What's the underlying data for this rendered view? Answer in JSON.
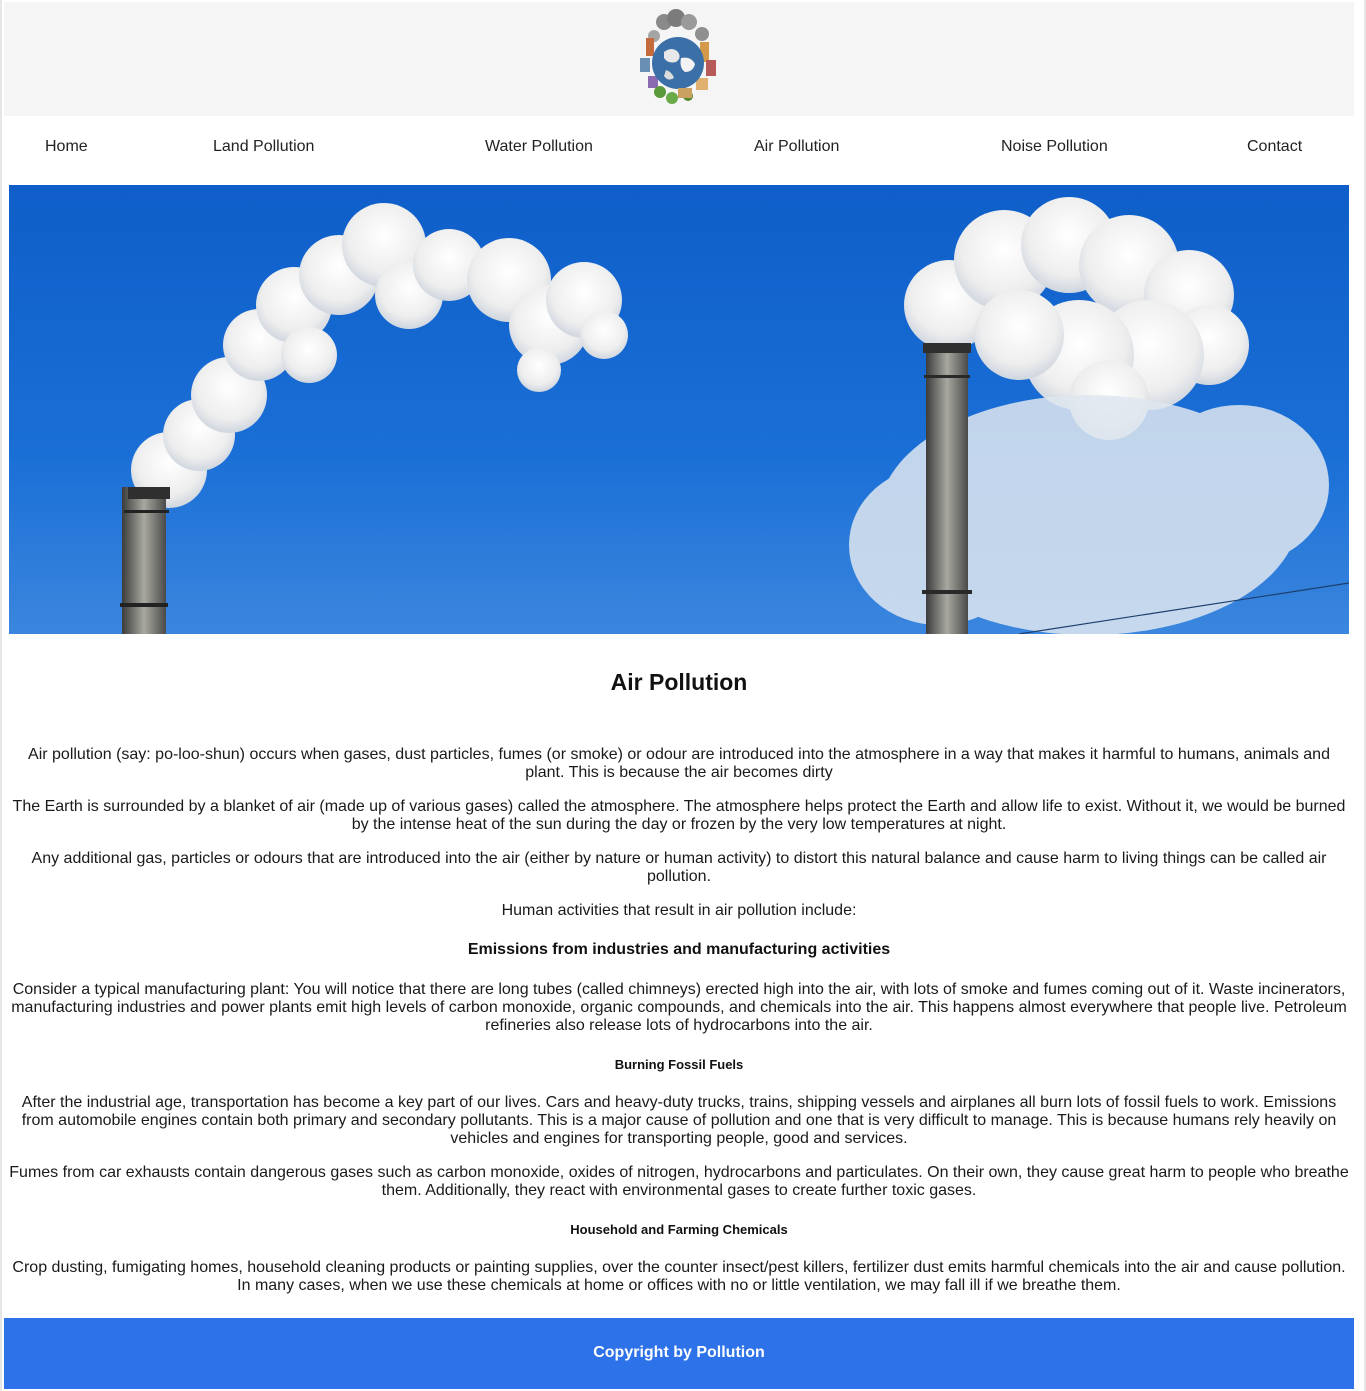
{
  "header": {
    "logo_icon": "polluted-earth-logo"
  },
  "nav": {
    "items": [
      {
        "label": "Home"
      },
      {
        "label": "Land Pollution"
      },
      {
        "label": "Water Pollution"
      },
      {
        "label": "Air Pollution"
      },
      {
        "label": "Noise Pollution"
      },
      {
        "label": "Contact"
      }
    ]
  },
  "hero": {
    "image": "smokestacks-blue-sky"
  },
  "main": {
    "title": "Air Pollution",
    "paragraphs": [
      "Air pollution (say: po-loo-shun) occurs when gases, dust particles, fumes (or smoke) or odour are introduced into the atmosphere in a way that makes it harmful to humans, animals and plant. This is because the air becomes dirty",
      "The Earth is surrounded by a blanket of air (made up of various gases) called the atmosphere. The atmosphere helps protect the Earth and allow life to exist. Without it, we would be burned by the intense heat of the sun during the day or frozen by the very low temperatures at night.",
      "Any additional gas, particles or odours that are introduced into the air (either by nature or human activity) to distort this natural balance and cause harm to living things can be called air pollution.",
      "Human activities that result in air pollution include:"
    ],
    "section1": {
      "heading": "Emissions from industries and manufacturing activities",
      "text": "Consider a typical manufacturing plant: You will notice that there are long tubes (called chimneys) erected high into the air, with lots of smoke and fumes coming out of it. Waste incinerators, manufacturing industries and power plants emit high levels of carbon monoxide, organic compounds, and chemicals into the air. This happens almost everywhere that people live. Petroleum refineries also release lots of hydrocarbons into the air."
    },
    "section2": {
      "heading": "Burning Fossil Fuels",
      "text1": "After the industrial age, transportation has become a key part of our lives. Cars and heavy-duty trucks, trains, shipping vessels and airplanes all burn lots of fossil fuels to work. Emissions from automobile engines contain both primary and secondary pollutants. This is a major cause of pollution and one that is very difficult to manage. This is because humans rely heavily on vehicles and engines for transporting people, good and services.",
      "text2": "Fumes from car exhausts contain dangerous gases such as carbon monoxide, oxides of nitrogen, hydrocarbons and particulates. On their own, they cause great harm to people who breathe them. Additionally, they react with environmental gases to create further toxic gases."
    },
    "section3": {
      "heading": "Household and Farming Chemicals",
      "text": "Crop dusting, fumigating homes, household cleaning products or painting supplies, over the counter insect/pest killers, fertilizer dust emits harmful chemicals into the air and cause pollution. In many cases, when we use these chemicals at home or offices with no or little ventilation, we may fall ill if we breathe them."
    }
  },
  "footer": {
    "text": "Copyright by Pollution",
    "color": "#2d72e8"
  }
}
